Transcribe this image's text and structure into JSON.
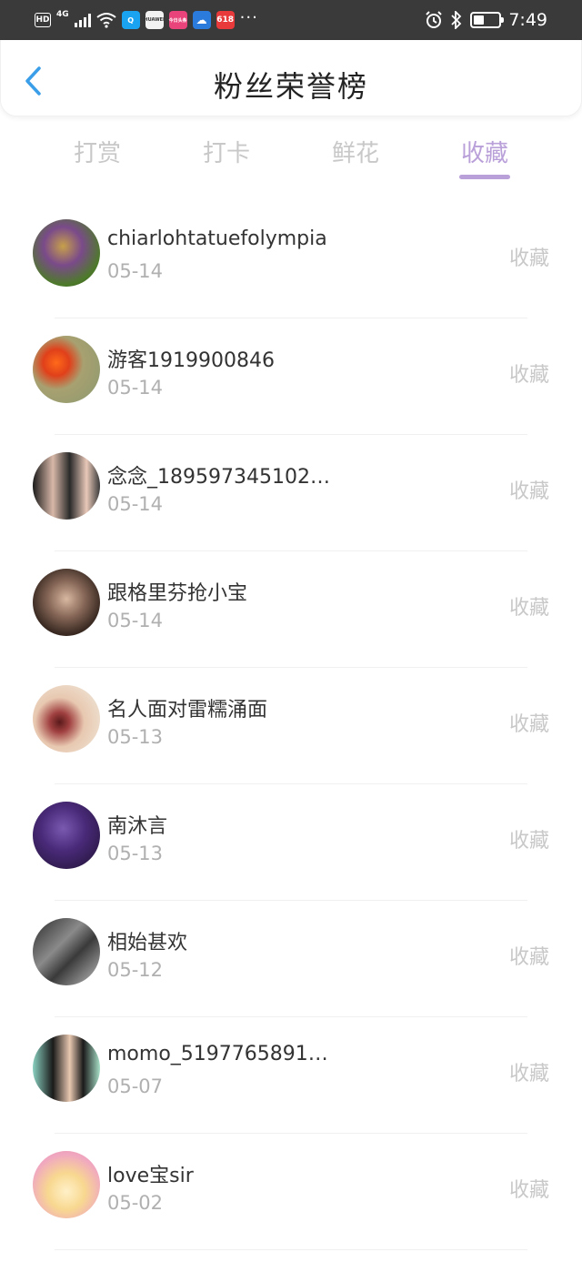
{
  "status_bar": {
    "hd": "HD",
    "network": "4G",
    "app_badges": [
      "Q",
      "HUAWEI",
      "今日头条",
      "☁",
      "618"
    ],
    "more": "···",
    "time": "7:49"
  },
  "header": {
    "title": "粉丝荣誉榜",
    "back_icon": "chevron-left-icon"
  },
  "tabs": [
    {
      "label": "打赏",
      "active": false
    },
    {
      "label": "打卡",
      "active": false
    },
    {
      "label": "鲜花",
      "active": false
    },
    {
      "label": "收藏",
      "active": true
    }
  ],
  "colors": {
    "accent": "#b9a0d9",
    "back_arrow": "#3a9ee8",
    "inactive_text": "#c8c8c8"
  },
  "fans": [
    {
      "name": "chiarlohtatuefolympia",
      "date": "05-14",
      "action": "收藏"
    },
    {
      "name": "游客1919900846",
      "date": "05-14",
      "action": "收藏"
    },
    {
      "name": "念念_189597345102…",
      "date": "05-14",
      "action": "收藏"
    },
    {
      "name": "跟格里芬抢小宝",
      "date": "05-14",
      "action": "收藏"
    },
    {
      "name": "名人面对雷糯涌面",
      "date": "05-13",
      "action": "收藏"
    },
    {
      "name": "南沐言",
      "date": "05-13",
      "action": "收藏"
    },
    {
      "name": "相始甚欢",
      "date": "05-12",
      "action": "收藏"
    },
    {
      "name": "momo_5197765891…",
      "date": "05-07",
      "action": "收藏"
    },
    {
      "name": "love宝sir",
      "date": "05-02",
      "action": "收藏"
    }
  ]
}
